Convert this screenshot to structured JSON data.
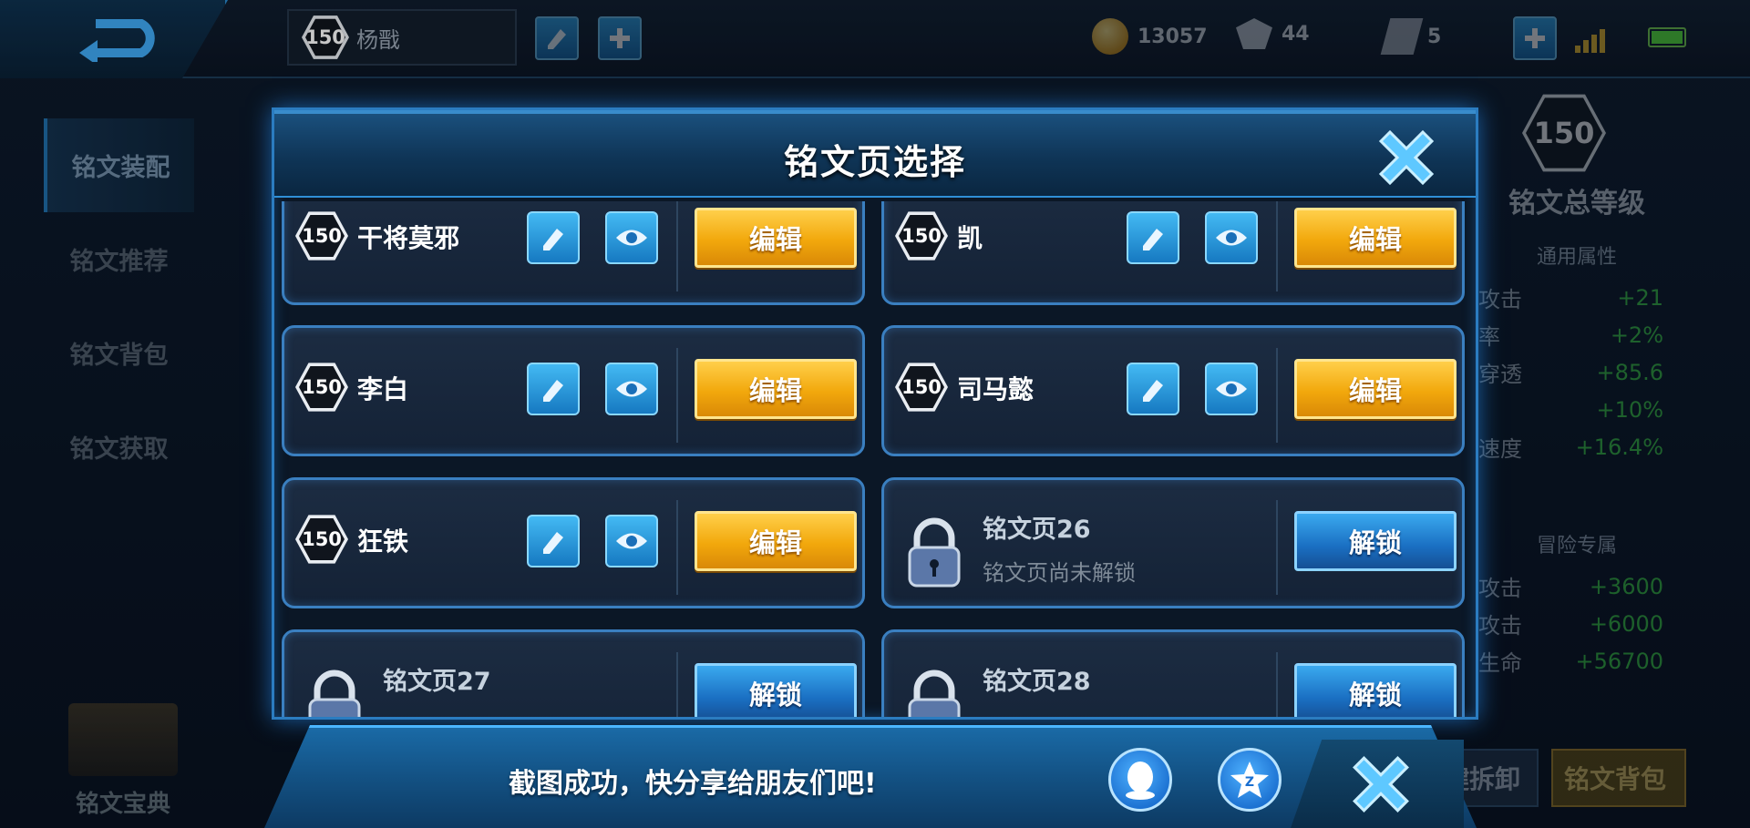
{
  "player": {
    "level": "150",
    "name": "杨戬"
  },
  "currencies": [
    {
      "icon": "gold-coin-icon",
      "value": "13057"
    },
    {
      "icon": "diamond-icon",
      "value": "44"
    },
    {
      "icon": "crystal-icon",
      "value": "5"
    }
  ],
  "left_nav": [
    {
      "label": "铭文装配",
      "active": true
    },
    {
      "label": "铭文推荐",
      "active": false
    },
    {
      "label": "铭文背包",
      "active": false
    },
    {
      "label": "铭文获取",
      "active": false
    }
  ],
  "codex_label": "铭文宝典",
  "right_panel": {
    "level": "150",
    "title": "铭文总等级",
    "general_title": "通用属性",
    "general_stats": [
      {
        "k": "攻击",
        "v": "+21"
      },
      {
        "k": "率",
        "v": "+2%"
      },
      {
        "k": "穿透",
        "v": "+85.6"
      },
      {
        "k": "",
        "v": "+10%"
      },
      {
        "k": "速度",
        "v": "+16.4%"
      }
    ],
    "adventure_title": "冒险专属",
    "adventure_stats": [
      {
        "k": "攻击",
        "v": "+3600"
      },
      {
        "k": "攻击",
        "v": "+6000"
      },
      {
        "k": "生命",
        "v": "+56700"
      }
    ],
    "unload_label": "键拆卸",
    "bag_label": "铭文背包"
  },
  "modal": {
    "title": "铭文页选择",
    "edit_label": "编辑",
    "unlock_label": "解锁",
    "locked_subtitle": "铭文页尚未解锁",
    "pages": [
      {
        "level": "150",
        "name": "干将莫邪"
      },
      {
        "level": "150",
        "name": "凯"
      },
      {
        "level": "150",
        "name": "李白"
      },
      {
        "level": "150",
        "name": "司马懿"
      },
      {
        "level": "150",
        "name": "狂铁"
      }
    ],
    "locked_pages": [
      {
        "name": "铭文页26"
      },
      {
        "name": "铭文页27"
      },
      {
        "name": "铭文页28"
      }
    ]
  },
  "share": {
    "text": "截图成功，快分享给朋友们吧!"
  },
  "colors": {
    "gold_button": "#f2a80c",
    "blue_button": "#1a6fc2",
    "stat_green": "#3fd24a",
    "frame_blue": "#2b7cc0"
  }
}
